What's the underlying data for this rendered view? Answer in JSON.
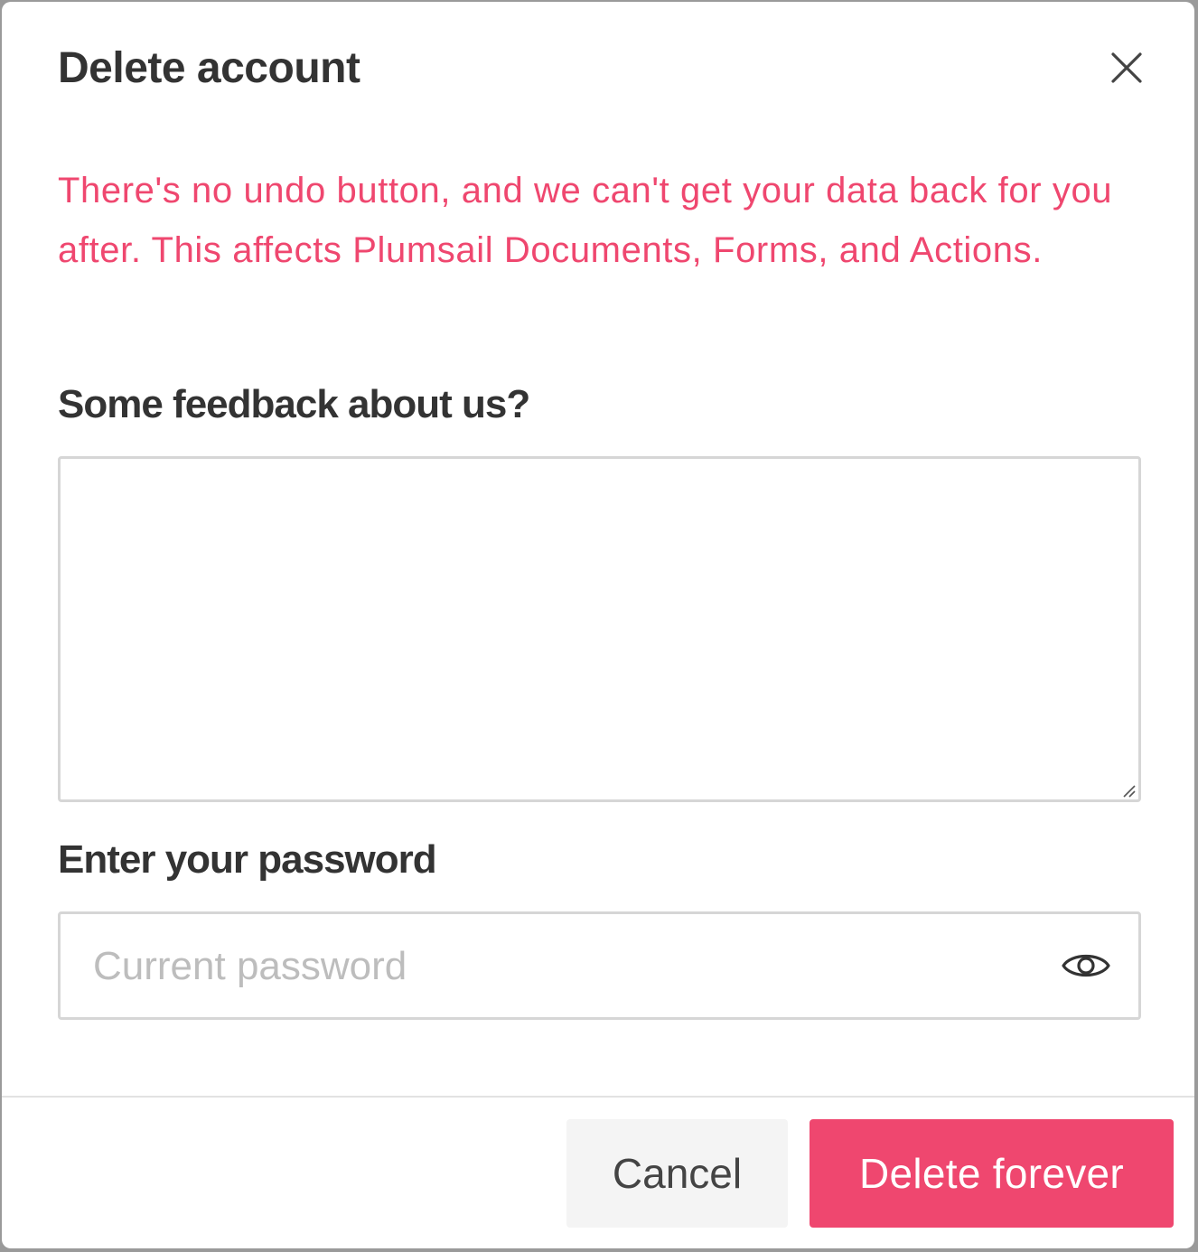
{
  "dialog": {
    "title": "Delete account",
    "warning": "There's no undo button, and we can't get your data back for you after. This affects Plumsail Documents, Forms, and Actions.",
    "accent_color": "#ef476f"
  },
  "feedback": {
    "label": "Some feedback about us?",
    "value": ""
  },
  "password": {
    "label": "Enter your password",
    "placeholder": "Current password",
    "value": "",
    "toggle_icon": "eye-icon"
  },
  "footer": {
    "cancel_label": "Cancel",
    "delete_label": "Delete forever"
  },
  "icons": {
    "close": "close-icon",
    "visibility": "eye-icon"
  }
}
